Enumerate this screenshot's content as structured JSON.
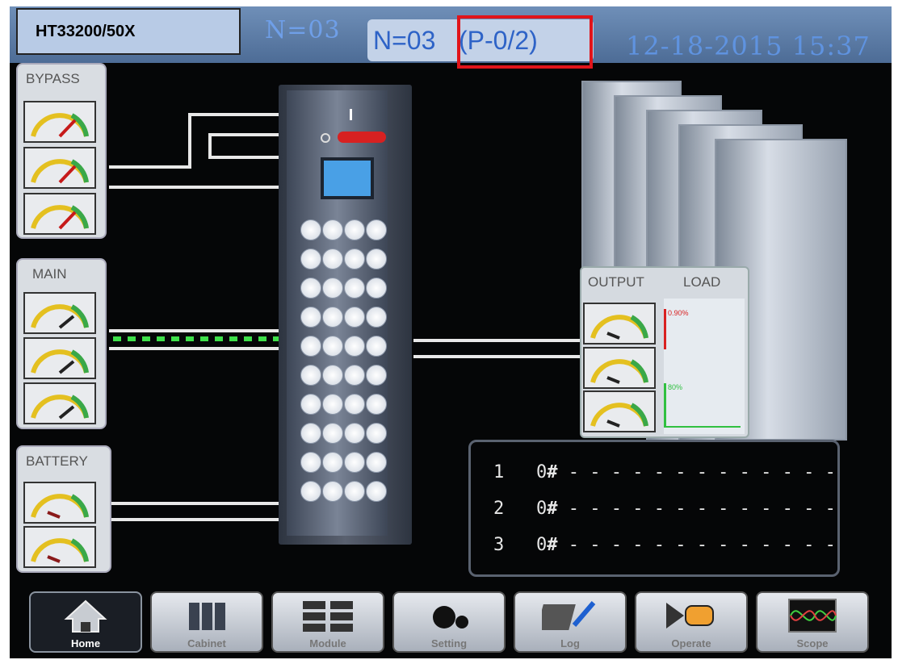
{
  "title_box": "HT33200/50X",
  "header": {
    "n_faded": "N=03",
    "n_current": "N=03",
    "parallel": "(P-0/2)",
    "datetime": "12-18-2015 15:37"
  },
  "panels": {
    "bypass": "BYPASS",
    "main": "MAIN",
    "battery": "BATTERY",
    "output": "OUTPUT",
    "load": "LOAD"
  },
  "load_bar_labels": {
    "top": "0.90%",
    "bottom": "80%"
  },
  "parallel_table": [
    {
      "index": "1",
      "id": "0",
      "hash": "#",
      "dashes": "- - - - - - - - - - - - -"
    },
    {
      "index": "2",
      "id": "0",
      "hash": "#",
      "dashes": "- - - - - - - - - - - - -"
    },
    {
      "index": "3",
      "id": "0",
      "hash": "#",
      "dashes": "- - - - - - - - - - - - -"
    }
  ],
  "toolbar": [
    {
      "label": "Home",
      "icon": "home-icon"
    },
    {
      "label": "Cabinet",
      "icon": "cabinet-icon"
    },
    {
      "label": "Module",
      "icon": "module-icon"
    },
    {
      "label": "Setting",
      "icon": "gear-icon"
    },
    {
      "label": "Log",
      "icon": "log-icon"
    },
    {
      "label": "Operate",
      "icon": "hand-pointer-icon"
    },
    {
      "label": "Scope",
      "icon": "oscilloscope-icon"
    }
  ],
  "colors": {
    "background": "#050607",
    "header_text": "#2e63c7",
    "highlight_box": "#e0141a",
    "title_box": "#b8cbe6"
  }
}
